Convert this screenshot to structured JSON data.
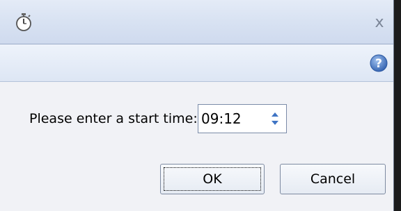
{
  "window": {
    "title_icon": "stopwatch-icon",
    "close_label": "x",
    "help_icon": "help-icon"
  },
  "form": {
    "prompt": "Please enter a start time:",
    "time_value": "09:12"
  },
  "buttons": {
    "ok": "OK",
    "cancel": "Cancel"
  },
  "colors": {
    "titlebar": "#d8e2f2",
    "help_icon": "#4a78c2",
    "content_bg": "#f1f2f6"
  }
}
